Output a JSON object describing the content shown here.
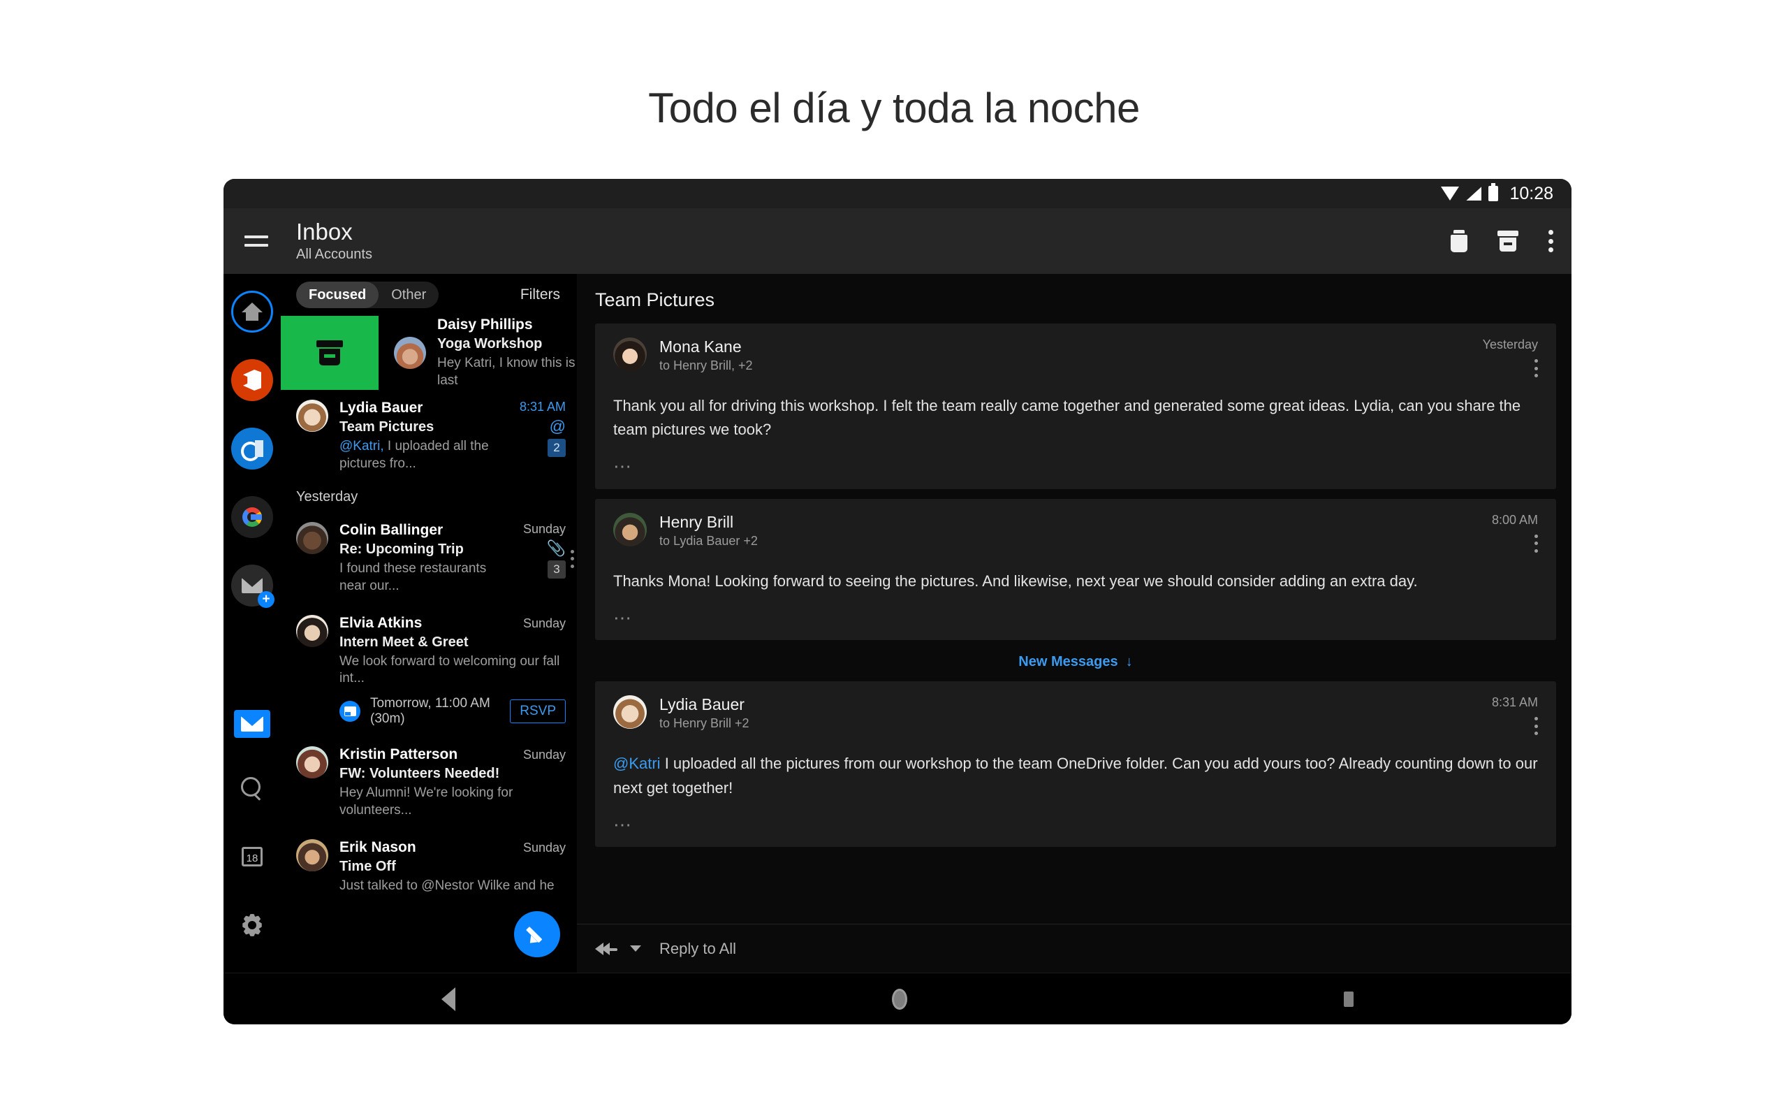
{
  "page": {
    "title": "Todo el día y toda la noche"
  },
  "status_bar": {
    "time": "10:28",
    "icons": [
      "wifi-icon",
      "signal-icon",
      "battery-icon"
    ]
  },
  "app_bar": {
    "menu_icon": "hamburger-icon",
    "title": "Inbox",
    "subtitle": "All Accounts",
    "actions": [
      "delete-icon",
      "archive-icon",
      "more-vertical-icon"
    ]
  },
  "rail": {
    "top_items": [
      {
        "name": "home",
        "icon": "home-icon"
      },
      {
        "name": "office",
        "icon": "office-icon"
      },
      {
        "name": "outlook",
        "icon": "outlook-icon"
      },
      {
        "name": "google",
        "icon": "google-icon"
      },
      {
        "name": "add-account",
        "icon": "envelope-plus-icon"
      }
    ],
    "bottom_items": [
      {
        "name": "mail",
        "icon": "mail-icon",
        "active": true
      },
      {
        "name": "search",
        "icon": "search-icon"
      },
      {
        "name": "calendar",
        "icon": "calendar-icon",
        "day": "18"
      },
      {
        "name": "settings",
        "icon": "gear-icon"
      }
    ]
  },
  "list": {
    "pivots": [
      {
        "label": "Focused",
        "selected": true
      },
      {
        "label": "Other",
        "selected": false
      }
    ],
    "filters_label": "Filters",
    "swipe_row": {
      "action_icon": "archive-icon",
      "sender": "Daisy Phillips",
      "subject": "Yoga Workshop",
      "preview": "Hey Katri, I know this is last"
    },
    "section_header": "Yesterday",
    "items": [
      {
        "sender": "Lydia Bauer",
        "subject": "Team Pictures",
        "preview_mention": "@Katri,",
        "preview": " I uploaded all the pictures fro...",
        "time": "8:31 AM",
        "mention": "@",
        "badge": "2",
        "selected": true
      },
      {
        "sender": "Colin Ballinger",
        "subject": "Re: Upcoming Trip",
        "preview": "I found these restaurants near our...",
        "time": "Sunday",
        "attachment": true,
        "badge": "3"
      },
      {
        "sender": "Elvia Atkins",
        "subject": "Intern Meet & Greet",
        "preview": "We look forward to welcoming our fall int...",
        "time": "Sunday",
        "invite_text": "Tomorrow, 11:00 AM (30m)",
        "rsvp_label": "RSVP"
      },
      {
        "sender": "Kristin Patterson",
        "subject": "FW: Volunteers Needed!",
        "preview": "Hey Alumni! We're looking for volunteers...",
        "time": "Sunday"
      },
      {
        "sender": "Erik Nason",
        "subject": "Time Off",
        "preview": "Just talked to @Nestor Wilke and he",
        "time": "Sunday"
      }
    ],
    "compose_icon": "pencil-icon"
  },
  "reader": {
    "title": "Team Pictures",
    "new_messages_label": "New Messages",
    "new_messages_icon": "arrow-down-icon",
    "messages": [
      {
        "from": "Mona Kane",
        "to": "to Henry Brill, +2",
        "time": "Yesterday",
        "body": "Thank you all for driving this workshop. I felt the team really came together and generated some great ideas. Lydia, can you share the team pictures we took?"
      },
      {
        "from": "Henry Brill",
        "to": "to Lydia Bauer +2",
        "time": "8:00 AM",
        "body": "Thanks Mona! Looking forward to seeing the pictures. And likewise, next year we should consider adding an extra day."
      },
      {
        "from": "Lydia Bauer",
        "to": "to Henry Brill +2",
        "time": "8:31 AM",
        "body_mention": "@Katri",
        "body": " I uploaded all the pictures from our workshop to the team OneDrive folder. Can you add yours too? Already counting down to our next get together!"
      }
    ],
    "reply_label": "Reply to All",
    "reply_icon": "reply-all-icon",
    "reply_caret": "chevron-down-icon"
  },
  "nav_bar": {
    "back": "back-icon",
    "home": "home-circle-icon",
    "recents": "recents-icon"
  },
  "colors": {
    "accent": "#0a84ff",
    "archive_green": "#18b84a",
    "office_red": "#d83b01",
    "card": "#1c1c1c"
  }
}
